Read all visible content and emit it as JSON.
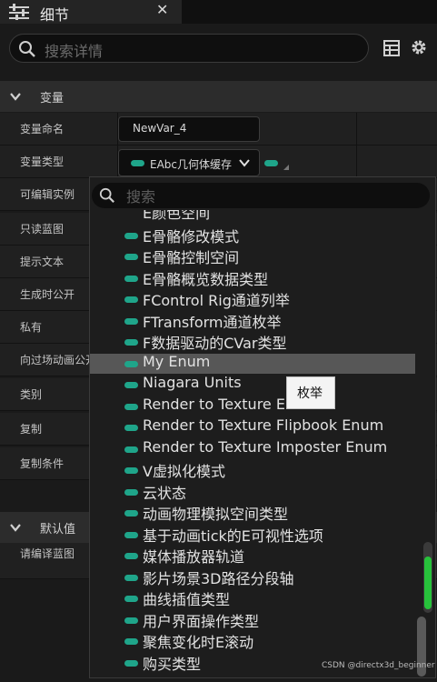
{
  "tab": {
    "title": "细节",
    "close": "✕"
  },
  "search": {
    "placeholder": "搜索详情"
  },
  "sections": {
    "variables": "变量",
    "defaults": "默认值"
  },
  "properties": [
    {
      "label": "变量命名"
    },
    {
      "label": "变量类型"
    },
    {
      "label": "可编辑实例"
    },
    {
      "label": "只读蓝图"
    },
    {
      "label": "提示文本"
    },
    {
      "label": "生成时公开"
    },
    {
      "label": "私有"
    },
    {
      "label": "向过场动画公开"
    },
    {
      "label": "类别"
    },
    {
      "label": "复制"
    },
    {
      "label": "复制条件"
    }
  ],
  "defaults_hint": "请编译蓝图",
  "var_name_value": "NewVar_4",
  "var_type_value": "EAbc几何体缓存",
  "popup": {
    "search_placeholder": "搜索",
    "items": [
      "E颜色空间",
      "E骨骼修改模式",
      "E骨骼控制空间",
      "E骨骼概览数据类型",
      "FControl Rig通道列举",
      "FTransform通道枚举",
      "F数据驱动的CVar类型",
      "My Enum",
      "Niagara Units",
      "Render to Texture Er",
      "Render to Texture Flipbook Enum",
      "Render to Texture Imposter Enum",
      "V虚拟化模式",
      "云状态",
      "动画物理模拟空间类型",
      "基于动画tick的E可视性选项",
      "媒体播放器轨道",
      "影片场景3D路径分段轴",
      "曲线插值类型",
      "用户界面操作类型",
      "聚焦变化时E滚动",
      "购买类型"
    ],
    "selected_index": 7
  },
  "tooltip": "枚举",
  "watermark": "CSDN @directx3d_beginner",
  "colors": {
    "accent_pill": "#1fa58a",
    "selection": "#575757",
    "scroll_green": "#27c23b"
  }
}
